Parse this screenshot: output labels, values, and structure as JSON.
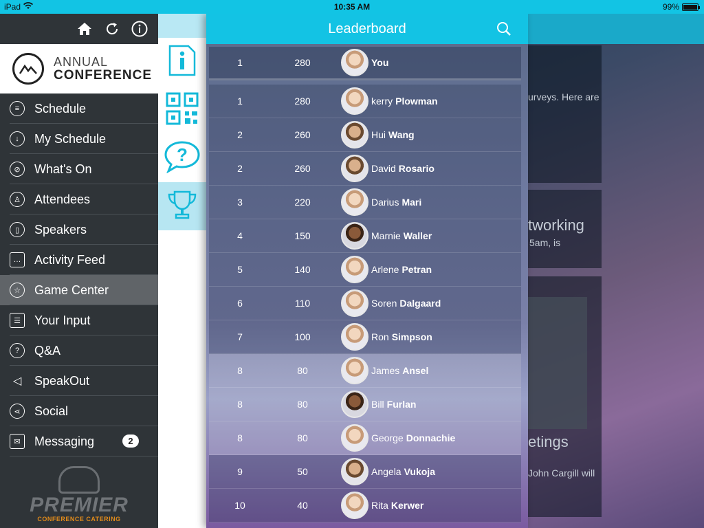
{
  "status_bar": {
    "device": "iPad",
    "time": "10:35 AM",
    "battery": "99%",
    "battery_level": 0.99
  },
  "sidebar": {
    "logo": {
      "line1": "ANNUAL",
      "line2": "CONFERENCE"
    },
    "items": [
      {
        "label": "Schedule",
        "icon": "list-icon"
      },
      {
        "label": "My Schedule",
        "icon": "download-icon"
      },
      {
        "label": "What's On",
        "icon": "compass-icon"
      },
      {
        "label": "Attendees",
        "icon": "person-icon"
      },
      {
        "label": "Speakers",
        "icon": "phone-icon"
      },
      {
        "label": "Activity Feed",
        "icon": "chat-icon"
      },
      {
        "label": "Game Center",
        "icon": "star-icon",
        "active": true
      },
      {
        "label": "Your Input",
        "icon": "checklist-icon"
      },
      {
        "label": "Q&A",
        "icon": "question-icon"
      },
      {
        "label": "SpeakOut",
        "icon": "megaphone-icon"
      },
      {
        "label": "Social",
        "icon": "share-icon"
      },
      {
        "label": "Messaging",
        "icon": "mail-icon",
        "badge": "2"
      }
    ],
    "sponsor": {
      "name": "PREMIER",
      "sub": "CONFERENCE CATERING"
    }
  },
  "background": {
    "snippet1": "urveys. Here are",
    "snippet2": "tworking",
    "snippet3": "5am, is",
    "snippet4": "etings",
    "snippet5": "John Cargill will"
  },
  "leaderboard": {
    "title": "Leaderboard",
    "me": {
      "rank": "1",
      "points": "280",
      "name": "You"
    },
    "rows": [
      {
        "rank": "1",
        "points": "280",
        "first": "kerry",
        "last": "Plowman"
      },
      {
        "rank": "2",
        "points": "260",
        "first": "Hui",
        "last": "Wang"
      },
      {
        "rank": "2",
        "points": "260",
        "first": "David",
        "last": "Rosario"
      },
      {
        "rank": "3",
        "points": "220",
        "first": "Darius",
        "last": "Mari"
      },
      {
        "rank": "4",
        "points": "150",
        "first": "Marnie",
        "last": "Waller"
      },
      {
        "rank": "5",
        "points": "140",
        "first": "Arlene",
        "last": "Petran"
      },
      {
        "rank": "6",
        "points": "110",
        "first": "Soren",
        "last": "Dalgaard"
      },
      {
        "rank": "7",
        "points": "100",
        "first": "Ron",
        "last": "Simpson"
      },
      {
        "rank": "8",
        "points": "80",
        "first": "James",
        "last": "Ansel"
      },
      {
        "rank": "8",
        "points": "80",
        "first": "Bill",
        "last": "Furlan"
      },
      {
        "rank": "8",
        "points": "80",
        "first": "George",
        "last": "Donnachie"
      },
      {
        "rank": "9",
        "points": "50",
        "first": "Angela",
        "last": "Vukoja"
      },
      {
        "rank": "10",
        "points": "40",
        "first": "Rita",
        "last": "Kerwer"
      }
    ]
  },
  "colors": {
    "accent": "#13c3e4",
    "sidebar": "#2f3438",
    "active_item": "#606468",
    "brand_orange": "#e08a1a"
  }
}
